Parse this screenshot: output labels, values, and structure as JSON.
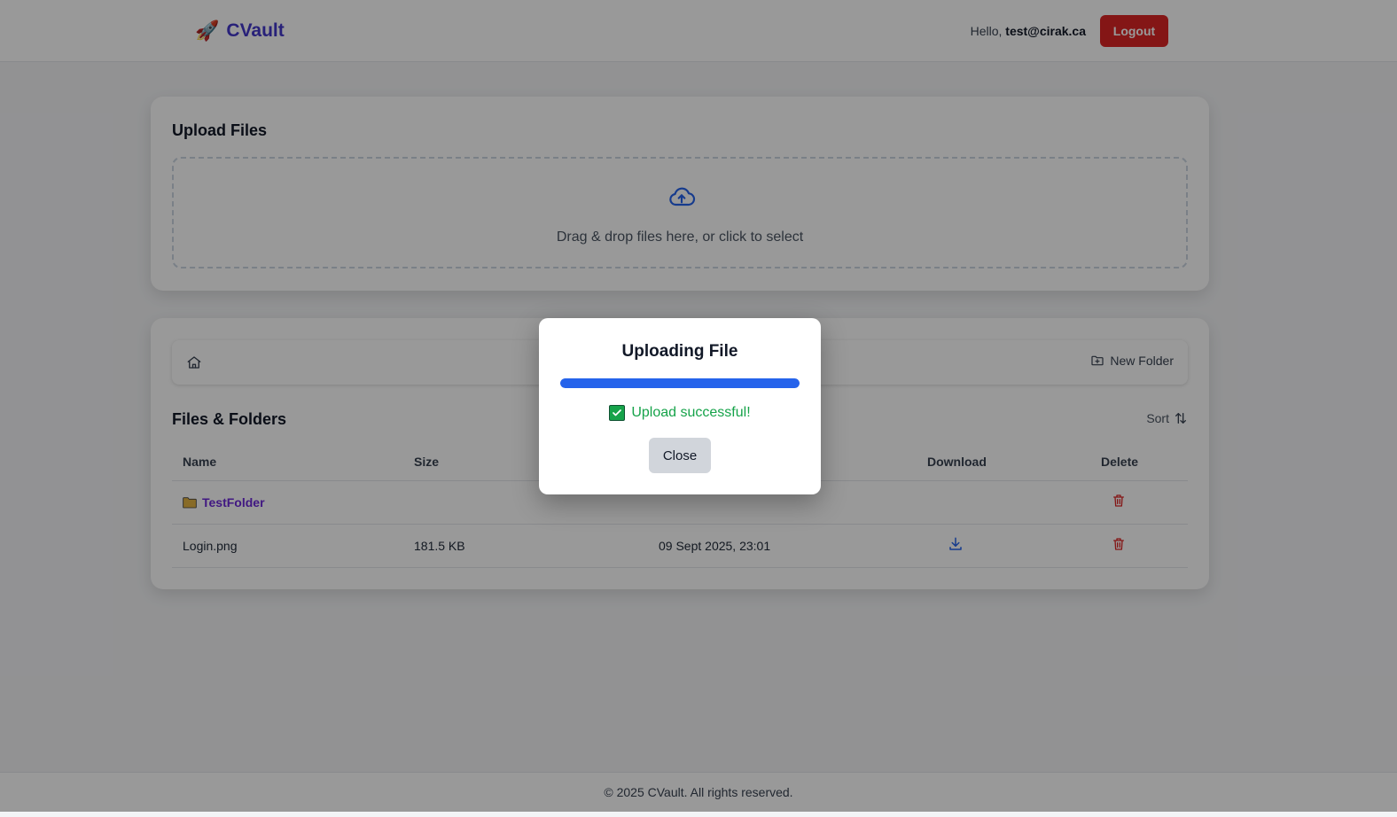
{
  "header": {
    "brand_icon": "rocket-icon",
    "brand_name": "CVault",
    "greeting_prefix": "Hello,",
    "user_email": "test@cirak.ca",
    "logout_label": "Logout",
    "logout_color": "#dc2626"
  },
  "upload": {
    "title": "Upload Files",
    "icon": "cloud-upload-icon",
    "dropzone_text": "Drag & drop files here, or click to select"
  },
  "files": {
    "toolbar": {
      "home_icon": "home-icon",
      "new_folder_label": "New Folder"
    },
    "title": "Files & Folders",
    "sort_label": "Sort",
    "columns": [
      "Name",
      "Size",
      "Download",
      "Delete"
    ],
    "rows": [
      {
        "type": "folder",
        "name": "TestFolder",
        "size": "",
        "date": ""
      },
      {
        "type": "file",
        "name": "Login.png",
        "size": "181.5 KB",
        "date": "09 Sept 2025, 23:01"
      }
    ]
  },
  "modal": {
    "title": "Uploading File",
    "progress_percent": 100,
    "progress_color": "#2563eb",
    "status_text": "Upload successful!",
    "status_color": "#16a34a",
    "close_label": "Close"
  },
  "footer": {
    "text": "© 2025 CVault. All rights reserved."
  }
}
